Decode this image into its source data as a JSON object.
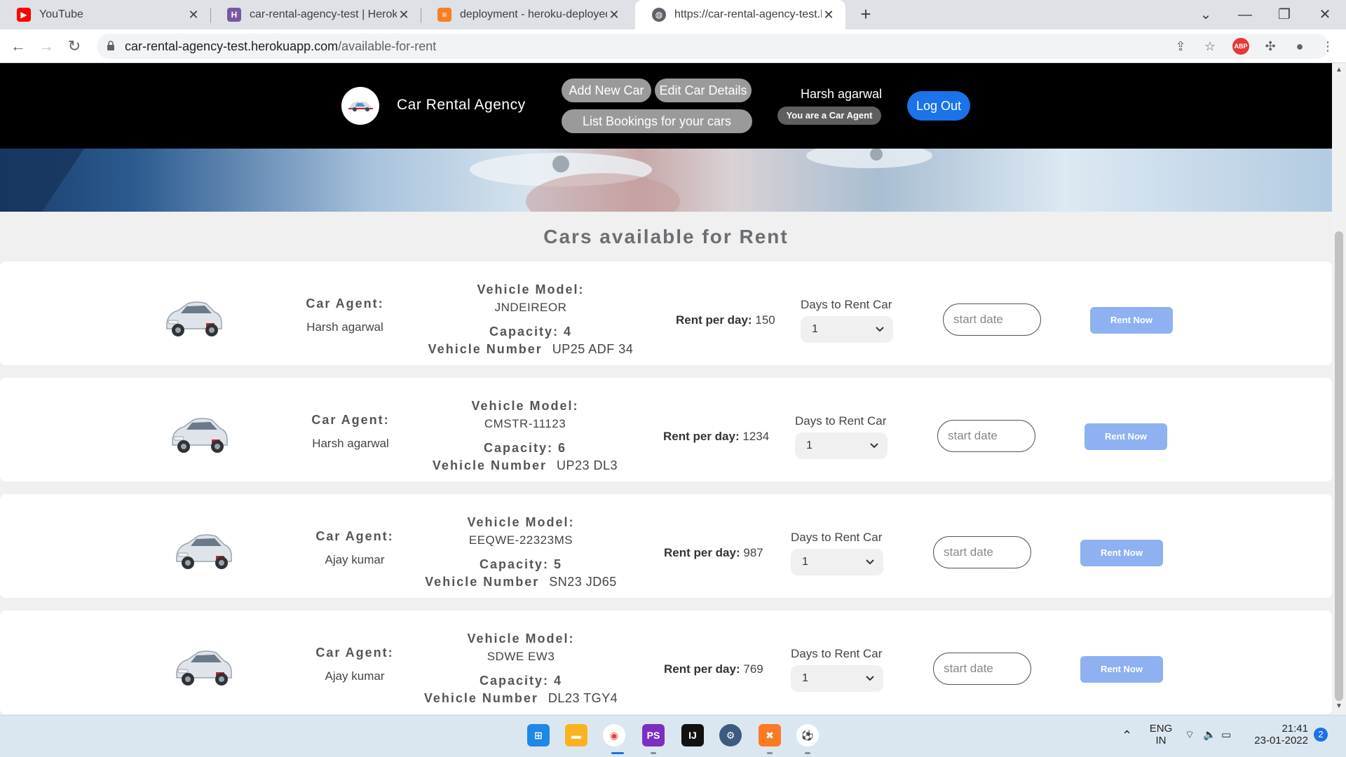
{
  "browser": {
    "tabs": [
      {
        "title": "YouTube",
        "icon": "youtube-icon",
        "active": false
      },
      {
        "title": "car-rental-agency-test | Heroku",
        "icon": "heroku-icon",
        "active": false
      },
      {
        "title": "deployment - heroku-deployed a",
        "icon": "stackoverflow-icon",
        "active": false
      },
      {
        "title": "https://car-rental-agency-test.he",
        "icon": "globe-icon",
        "active": true
      }
    ],
    "new_tab": "+",
    "url_domain": "car-rental-agency-test.herokuapp.com",
    "url_path": "/available-for-rent",
    "extension_badge": "ABP"
  },
  "header": {
    "site_title": "Car Rental Agency",
    "nav": {
      "add_car": "Add New Car",
      "edit_car": "Edit Car Details",
      "list_bookings": "List Bookings for your cars"
    },
    "user_name": "Harsh agarwal",
    "role_badge": "You are a Car Agent",
    "logout": "Log Out"
  },
  "main": {
    "heading": "Cars available for Rent",
    "cars": [
      {
        "agent_label": "Car Agent:",
        "agent": "Harsh agarwal",
        "model_label": "Vehicle Model:",
        "model": "JNDEIREOR",
        "capacity": "Capacity: 4",
        "number_label": "Vehicle Number",
        "number": "UP25 ADF 34",
        "rent_label": "Rent per day:",
        "rent": "150",
        "days_label": "Days to Rent Car",
        "days": "1",
        "date_placeholder": "start date",
        "button": "Rent Now"
      },
      {
        "agent_label": "Car Agent:",
        "agent": "Harsh agarwal",
        "model_label": "Vehicle Model:",
        "model": "CMSTR-11123",
        "capacity": "Capacity: 6",
        "number_label": "Vehicle Number",
        "number": "UP23 DL3",
        "rent_label": "Rent per day:",
        "rent": "1234",
        "days_label": "Days to Rent Car",
        "days": "1",
        "date_placeholder": "start date",
        "button": "Rent Now"
      },
      {
        "agent_label": "Car Agent:",
        "agent": "Ajay kumar",
        "model_label": "Vehicle Model:",
        "model": "EEQWE-22323MS",
        "capacity": "Capacity: 5",
        "number_label": "Vehicle Number",
        "number": "SN23 JD65",
        "rent_label": "Rent per day:",
        "rent": "987",
        "days_label": "Days to Rent Car",
        "days": "1",
        "date_placeholder": "start date",
        "button": "Rent Now"
      },
      {
        "agent_label": "Car Agent:",
        "agent": "Ajay kumar",
        "model_label": "Vehicle Model:",
        "model": "SDWE EW3",
        "capacity": "Capacity: 4",
        "number_label": "Vehicle Number",
        "number": "DL23 TGY4",
        "rent_label": "Rent per day:",
        "rent": "769",
        "days_label": "Days to Rent Car",
        "days": "1",
        "date_placeholder": "start date",
        "button": "Rent Now"
      }
    ]
  },
  "taskbar": {
    "lang_top": "ENG",
    "lang_bottom": "IN",
    "time": "21:41",
    "date": "23-01-2022",
    "notifications": "2",
    "apps": [
      "start-icon",
      "file-explorer-icon",
      "chrome-icon",
      "phpstorm-icon",
      "intellij-icon",
      "settings-icon",
      "xampp-icon",
      "soccer-app-icon"
    ]
  },
  "colors": {
    "header_bg": "#000000",
    "nav_pill": "#9a9a9a",
    "logout_btn": "#1a73e8",
    "rent_btn": "#8fb1f2"
  }
}
